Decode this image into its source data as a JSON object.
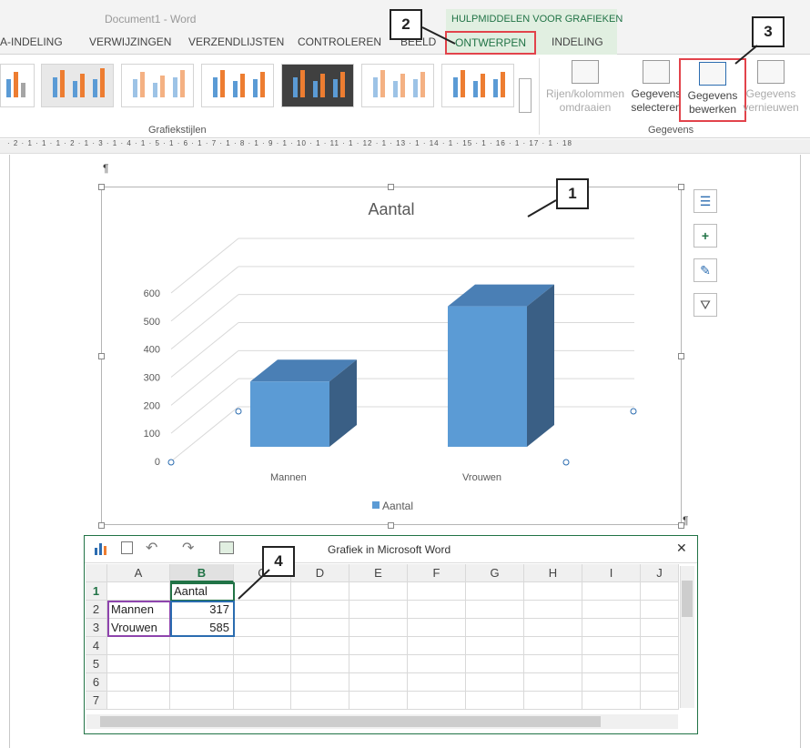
{
  "word": {
    "title": "Document1 - Word",
    "contextual_group": "HULPMIDDELEN VOOR GRAFIEKEN",
    "tabs": [
      "A-INDELING",
      "VERWIJZINGEN",
      "VERZENDLIJSTEN",
      "CONTROLEREN",
      "BEELD",
      "ONTWERPEN",
      "INDELING"
    ],
    "ribbon": {
      "group_chart_styles": "Grafiekstijlen",
      "group_data": "Gegevens",
      "btn_switch_1": "Rijen/kolommen",
      "btn_switch_2": "omdraaien",
      "btn_select_1": "Gegevens",
      "btn_select_2": "selecteren",
      "btn_edit_1": "Gegevens",
      "btn_edit_2": "bewerken",
      "btn_refresh_1": "Gegevens",
      "btn_refresh_2": "vernieuwen"
    },
    "ruler": "· 2 · 1 · 1 · 1 · 2 · 1 · 3 · 1 · 4 · 1 · 5 · 1 · 6 · 1 · 7 · 1 · 8 · 1 · 9 · 1 · 10 · 1 · 11 · 1 · 12 · 1 · 13 · 1 · 14 · 1 · 15 · 1 · 16 · 1 · 17 · 1 · 18",
    "pilcrow": "¶"
  },
  "chart_data": {
    "type": "bar",
    "title": "Aantal",
    "categories": [
      "Mannen",
      "Vrouwen"
    ],
    "series": [
      {
        "name": "Aantal",
        "values": [
          317,
          585
        ],
        "color": "#5b9bd5"
      }
    ],
    "yticks": [
      0,
      100,
      200,
      300,
      400,
      500,
      600
    ],
    "ylim": [
      0,
      700
    ],
    "legend": "bottom",
    "grid": true,
    "3d": true
  },
  "excel": {
    "title": "Grafiek in Microsoft Word",
    "close": "✕",
    "columns": [
      "A",
      "B",
      "C",
      "D",
      "E",
      "F",
      "G",
      "H",
      "I",
      "J"
    ],
    "rows": [
      {
        "num": "1",
        "a": "",
        "b": "Aantal"
      },
      {
        "num": "2",
        "a": "Mannen",
        "b": "317"
      },
      {
        "num": "3",
        "a": "Vrouwen",
        "b": "585"
      },
      {
        "num": "4",
        "a": "",
        "b": ""
      },
      {
        "num": "5",
        "a": "",
        "b": ""
      },
      {
        "num": "6",
        "a": "",
        "b": ""
      },
      {
        "num": "7",
        "a": "",
        "b": ""
      }
    ]
  },
  "callouts": [
    "1",
    "2",
    "3",
    "4"
  ],
  "colors": {
    "accent_red": "#e2434b",
    "excel_green": "#217346",
    "bar": "#5b9bd5"
  }
}
